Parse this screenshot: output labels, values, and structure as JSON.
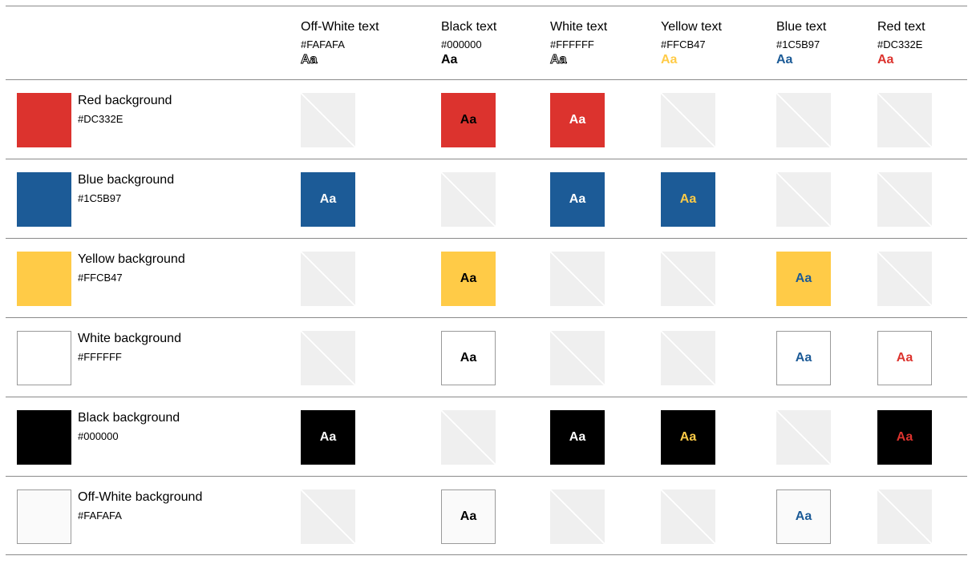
{
  "columns": [
    {
      "name": "Off-White text",
      "hex": "#FAFAFA",
      "sample": "Aa",
      "color": "#FAFAFA"
    },
    {
      "name": "Black text",
      "hex": "#000000",
      "sample": "Aa",
      "color": "#000000"
    },
    {
      "name": "White text",
      "hex": "#FFFFFF",
      "sample": "Aa",
      "color": "#FFFFFF"
    },
    {
      "name": "Yellow text",
      "hex": "#FFCB47",
      "sample": "Aa",
      "color": "#FFCB47"
    },
    {
      "name": "Blue text",
      "hex": "#1C5B97",
      "sample": "Aa",
      "color": "#1C5B97"
    },
    {
      "name": "Red text",
      "hex": "#DC332E",
      "sample": "Aa",
      "color": "#DC332E"
    }
  ],
  "rows": [
    {
      "name": "Red background",
      "hex": "#DC332E",
      "color": "#DC332E",
      "cells": [
        {
          "ok": false
        },
        {
          "ok": true,
          "label": "Aa",
          "bg": "#DC332E",
          "fg": "#000000"
        },
        {
          "ok": true,
          "label": "Aa",
          "bg": "#DC332E",
          "fg": "#FFFFFF"
        },
        {
          "ok": false
        },
        {
          "ok": false
        },
        {
          "ok": false
        }
      ]
    },
    {
      "name": "Blue background",
      "hex": "#1C5B97",
      "color": "#1C5B97",
      "cells": [
        {
          "ok": true,
          "label": "Aa",
          "bg": "#1C5B97",
          "fg": "#FAFAFA"
        },
        {
          "ok": false
        },
        {
          "ok": true,
          "label": "Aa",
          "bg": "#1C5B97",
          "fg": "#FFFFFF"
        },
        {
          "ok": true,
          "label": "Aa",
          "bg": "#1C5B97",
          "fg": "#FFCB47"
        },
        {
          "ok": false
        },
        {
          "ok": false
        }
      ]
    },
    {
      "name": "Yellow background",
      "hex": "#FFCB47",
      "color": "#FFCB47",
      "cells": [
        {
          "ok": false
        },
        {
          "ok": true,
          "label": "Aa",
          "bg": "#FFCB47",
          "fg": "#000000"
        },
        {
          "ok": false
        },
        {
          "ok": false
        },
        {
          "ok": true,
          "label": "Aa",
          "bg": "#FFCB47",
          "fg": "#1C5B97"
        },
        {
          "ok": false
        }
      ]
    },
    {
      "name": "White background",
      "hex": "#FFFFFF",
      "color": "#FFFFFF",
      "cells": [
        {
          "ok": false
        },
        {
          "ok": true,
          "label": "Aa",
          "bg": "#FFFFFF",
          "fg": "#000000"
        },
        {
          "ok": false
        },
        {
          "ok": false
        },
        {
          "ok": true,
          "label": "Aa",
          "bg": "#FFFFFF",
          "fg": "#1C5B97"
        },
        {
          "ok": true,
          "label": "Aa",
          "bg": "#FFFFFF",
          "fg": "#DC332E"
        }
      ]
    },
    {
      "name": "Black background",
      "hex": "#000000",
      "color": "#000000",
      "cells": [
        {
          "ok": true,
          "label": "Aa",
          "bg": "#000000",
          "fg": "#FAFAFA"
        },
        {
          "ok": false
        },
        {
          "ok": true,
          "label": "Aa",
          "bg": "#000000",
          "fg": "#FFFFFF"
        },
        {
          "ok": true,
          "label": "Aa",
          "bg": "#000000",
          "fg": "#FFCB47"
        },
        {
          "ok": false
        },
        {
          "ok": true,
          "label": "Aa",
          "bg": "#000000",
          "fg": "#DC332E"
        }
      ]
    },
    {
      "name": "Off-White background",
      "hex": "#FAFAFA",
      "color": "#FAFAFA",
      "cells": [
        {
          "ok": false
        },
        {
          "ok": true,
          "label": "Aa",
          "bg": "#FAFAFA",
          "fg": "#000000"
        },
        {
          "ok": false
        },
        {
          "ok": false
        },
        {
          "ok": true,
          "label": "Aa",
          "bg": "#FAFAFA",
          "fg": "#1C5B97"
        },
        {
          "ok": false
        }
      ]
    }
  ]
}
